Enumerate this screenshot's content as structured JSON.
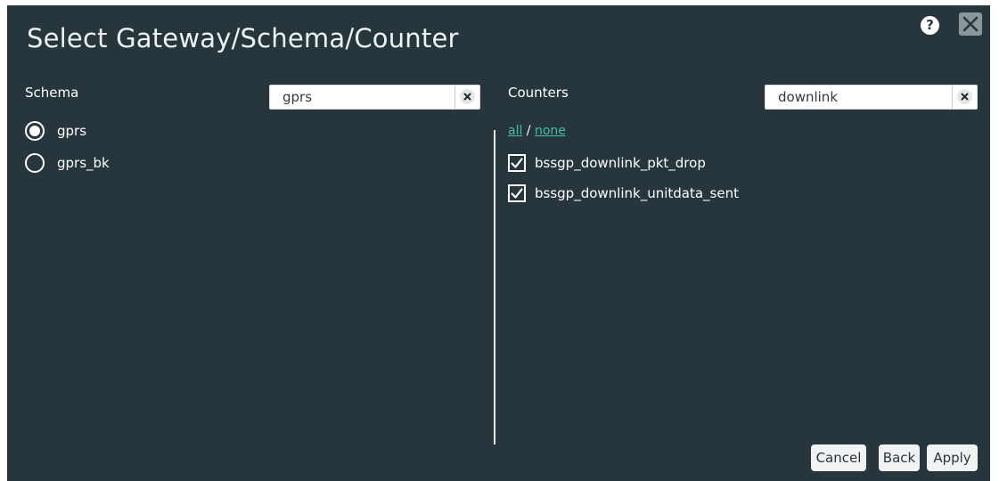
{
  "dialog": {
    "title": "Select Gateway/Schema/Counter",
    "help_icon": "question-mark-icon",
    "help_label": "?",
    "close_icon": "close-icon"
  },
  "schema": {
    "label": "Schema",
    "search": {
      "value": "gprs",
      "placeholder": ""
    },
    "clear_icon": "clear-x-icon",
    "options": [
      {
        "label": "gprs",
        "selected": true
      },
      {
        "label": "gprs_bk",
        "selected": false
      }
    ]
  },
  "counters": {
    "label": "Counters",
    "search": {
      "value": "downlink",
      "placeholder": ""
    },
    "clear_icon": "clear-x-icon",
    "select_all": "all",
    "separator": " / ",
    "select_none": "none",
    "items": [
      {
        "label": "bssgp_downlink_pkt_drop",
        "checked": true
      },
      {
        "label": "bssgp_downlink_unitdata_sent",
        "checked": true
      }
    ]
  },
  "footer": {
    "cancel_label": "Cancel",
    "back_label": "Back",
    "apply_label": "Apply"
  },
  "colors": {
    "background": "#27363d",
    "link": "#3fbfa6",
    "text": "#ffffff"
  }
}
